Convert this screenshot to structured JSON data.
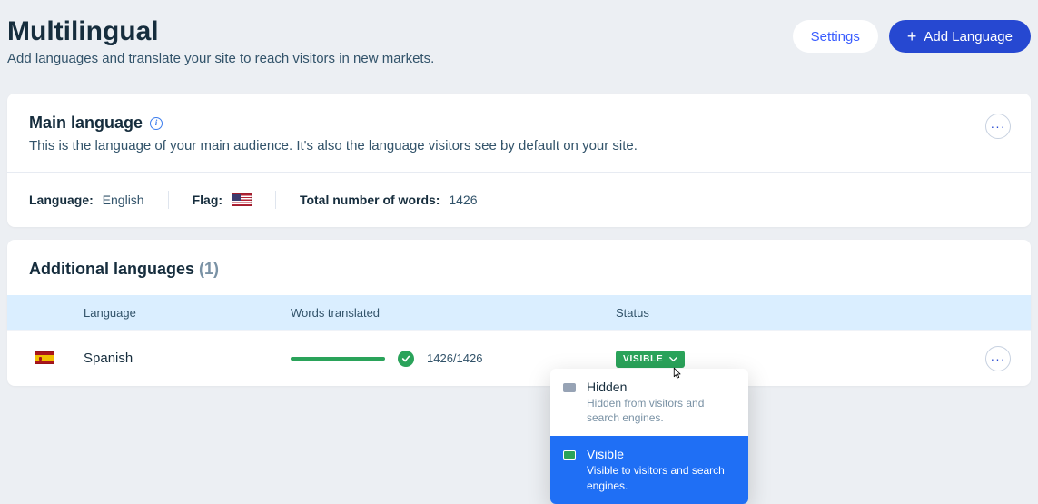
{
  "header": {
    "title": "Multilingual",
    "subtitle": "Add languages and translate your site to reach visitors in new markets.",
    "settings_label": "Settings",
    "add_language_label": "Add Language"
  },
  "main_language": {
    "title": "Main language",
    "description": "This is the language of your main audience. It's also the language visitors see by default on your site.",
    "language_label": "Language:",
    "language_value": "English",
    "flag_label": "Flag:",
    "words_label": "Total number of words:",
    "words_value": "1426"
  },
  "additional": {
    "title": "Additional languages",
    "count": "(1)",
    "columns": {
      "language": "Language",
      "words": "Words translated",
      "status": "Status"
    },
    "rows": [
      {
        "language": "Spanish",
        "words": "1426/1426",
        "status_label": "VISIBLE"
      }
    ]
  },
  "status_menu": {
    "hidden": {
      "title": "Hidden",
      "desc": "Hidden from visitors and search engines."
    },
    "visible": {
      "title": "Visible",
      "desc": "Visible to visitors and search engines."
    }
  }
}
